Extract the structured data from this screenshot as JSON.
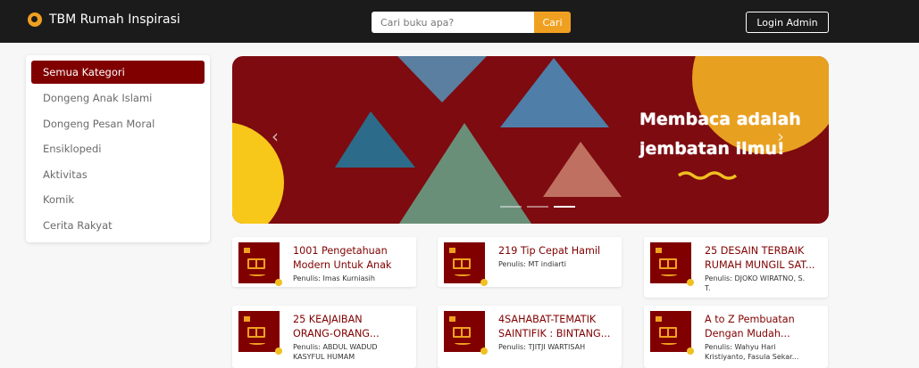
{
  "navbar": {
    "brand": "TBM Rumah Inspirasi",
    "search_placeholder": "Cari buku apa?",
    "search_button": "Cari",
    "login_button": "Login Admin"
  },
  "sidebar": {
    "items": [
      {
        "label": "Semua Kategori",
        "active": true
      },
      {
        "label": "Dongeng Anak Islami"
      },
      {
        "label": "Dongeng Pesan Moral"
      },
      {
        "label": "Ensiklopedi"
      },
      {
        "label": "Aktivitas"
      },
      {
        "label": "Komik"
      },
      {
        "label": "Cerita Rakyat"
      }
    ]
  },
  "banner": {
    "slogan_line1": "Membaca adalah",
    "slogan_line2": "jembatan ilmu!",
    "prev_icon": "chevron-left-icon",
    "next_icon": "chevron-right-icon"
  },
  "books": [
    {
      "title_line1": "1001 Pengetahuan",
      "title_line2": "Modern Untuk Anak",
      "author_line1": "Penulis: Imas Kurniasih",
      "author_line2": ""
    },
    {
      "title_line1": "219 Tip Cepat Hamil",
      "title_line2": "",
      "author_line1": "Penulis: MT indiarti",
      "author_line2": ""
    },
    {
      "title_line1": "25 DESAIN TERBAIK",
      "title_line2": "RUMAH MUNGIL SAT...",
      "author_line1": "Penulis: DJOKO WIRATNO, S.",
      "author_line2": "T."
    },
    {
      "title_line1": "25 KEAJAIBAN",
      "title_line2": "ORANG-ORANG...",
      "author_line1": "Penulis: ABDUL WADUD",
      "author_line2": "KASYFUL HUMAM"
    },
    {
      "title_line1": "4SAHABAT-TEMATIK",
      "title_line2": "SAINTIFIK : BINTANG...",
      "author_line1": "Penulis: TJITJI WARTISAH",
      "author_line2": ""
    },
    {
      "title_line1": "A to Z Pembuatan",
      "title_line2": "Dengan Mudah...",
      "author_line1": "Penulis: Wahyu Hari",
      "author_line2": "Kristiyanto, Fasula Sekar..."
    }
  ],
  "colors": {
    "navbar": "#1b1b1b",
    "accent": "#f0a020",
    "brand_red": "#800000"
  }
}
